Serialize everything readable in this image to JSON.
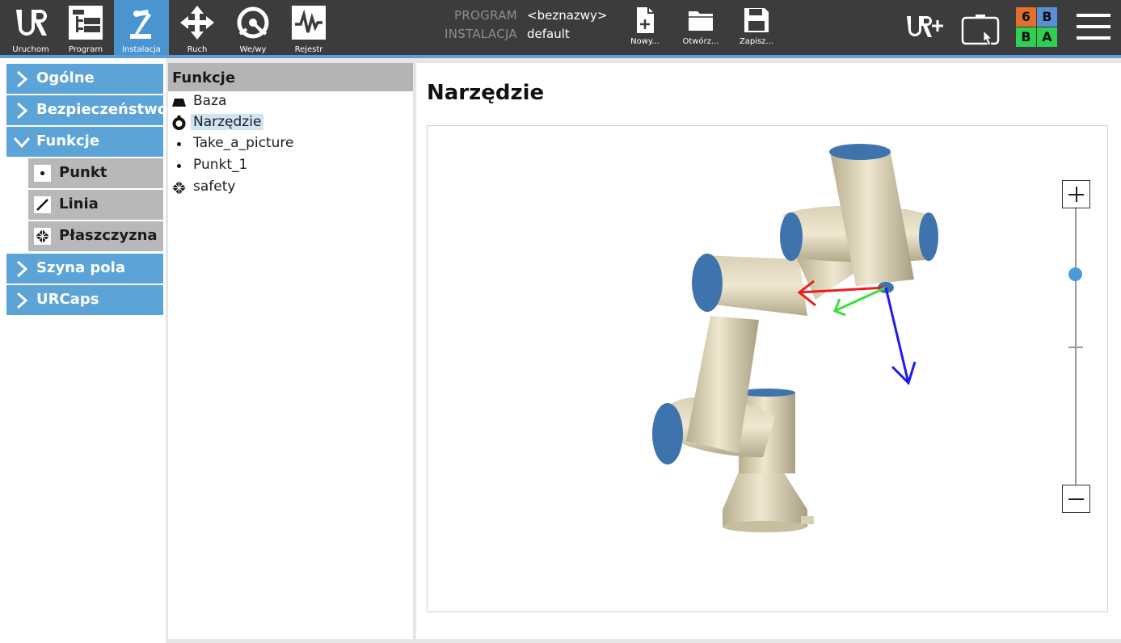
{
  "topbar": {
    "nav": [
      {
        "label": "Uruchom",
        "icon": "ur-logo-icon"
      },
      {
        "label": "Program",
        "icon": "program-tree-icon"
      },
      {
        "label": "Instalacja",
        "icon": "robot-arm-icon"
      },
      {
        "label": "Ruch",
        "icon": "move-arrows-icon"
      },
      {
        "label": "We/wy",
        "icon": "io-gauge-icon"
      },
      {
        "label": "Rejestr",
        "icon": "log-waveform-icon"
      }
    ],
    "program_label": "PROGRAM",
    "program_value": "<beznazwy>",
    "installation_label": "INSTALACJA",
    "installation_value": "default",
    "file_buttons": [
      {
        "label": "Nowy...",
        "icon": "new-file-icon"
      },
      {
        "label": "Otwórz...",
        "icon": "open-folder-icon"
      },
      {
        "label": "Zapisz...",
        "icon": "save-disk-icon"
      }
    ],
    "status": {
      "cells": [
        "6",
        "B",
        "B",
        "A"
      ],
      "colors": [
        "#e0702c",
        "#5a8fd6",
        "#2fcf52",
        "#2fcf52"
      ]
    },
    "accent_color": "#4a94cf"
  },
  "sidebar": {
    "items": [
      {
        "label": "Ogólne",
        "expanded": false
      },
      {
        "label": "Bezpieczeństwo",
        "expanded": false
      },
      {
        "label": "Funkcje",
        "expanded": true
      },
      {
        "label": "Szyna pola",
        "expanded": false
      },
      {
        "label": "URCaps",
        "expanded": false
      }
    ],
    "sub_items": [
      {
        "label": "Punkt",
        "icon": "point-icon"
      },
      {
        "label": "Linia",
        "icon": "line-icon"
      },
      {
        "label": "Płaszczyzna",
        "icon": "plane-icon"
      }
    ]
  },
  "features": {
    "header": "Funkcje",
    "rows": [
      {
        "label": "Baza",
        "icon": "base-icon"
      },
      {
        "label": "Narzędzie",
        "icon": "tool-icon",
        "selected": true
      },
      {
        "label": "Take_a_picture",
        "icon": "point-icon"
      },
      {
        "label": "Punkt_1",
        "icon": "point-icon"
      },
      {
        "label": "safety",
        "icon": "plane-icon"
      }
    ]
  },
  "content": {
    "title": "Narzędzie",
    "zoom_level": 0.76
  }
}
